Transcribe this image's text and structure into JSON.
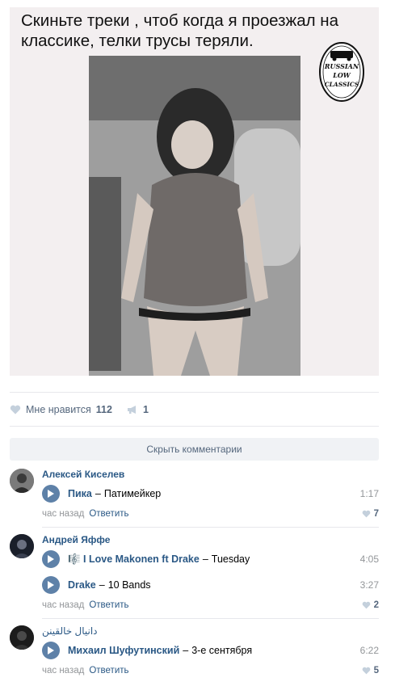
{
  "post": {
    "caption": "Скиньте треки , чтоб когда я проезжал на классике, телки трусы теряли.",
    "logo_lines": [
      "RUSSIAN",
      "LOW",
      "CLASSICS"
    ]
  },
  "actions": {
    "like_label": "Мне нравится",
    "like_count": "112",
    "share_count": "1"
  },
  "hide_comments_label": "Скрыть комментарии",
  "comments": [
    {
      "author": "Алексей Киселев",
      "tracks": [
        {
          "artist": "Пика",
          "dash": "–",
          "title": "Патимейкер",
          "duration": "1:17"
        }
      ],
      "time": "час назад",
      "reply": "Ответить",
      "likes": "7"
    },
    {
      "author": "Андрей Яффе",
      "tracks": [
        {
          "artist": "🎼 I Love Makonen ft Drake",
          "dash": "–",
          "title": "Tuesday",
          "duration": "4:05"
        },
        {
          "artist": "Drake",
          "dash": "–",
          "title": "10 Bands",
          "duration": "3:27"
        }
      ],
      "time": "час назад",
      "reply": "Ответить",
      "likes": "2"
    },
    {
      "author": "دانیال خالقینن",
      "tracks": [
        {
          "artist": "Михаил Шуфутинский",
          "dash": "–",
          "title": "3-е сентября",
          "duration": "6:22"
        }
      ],
      "time": "час назад",
      "reply": "Ответить",
      "likes": "5"
    }
  ],
  "colors": {
    "link": "#2a5885",
    "muted": "#939699",
    "play_button": "#5e81a8",
    "divider": "#e7e8ec",
    "hide_bar": "#f0f2f5"
  }
}
